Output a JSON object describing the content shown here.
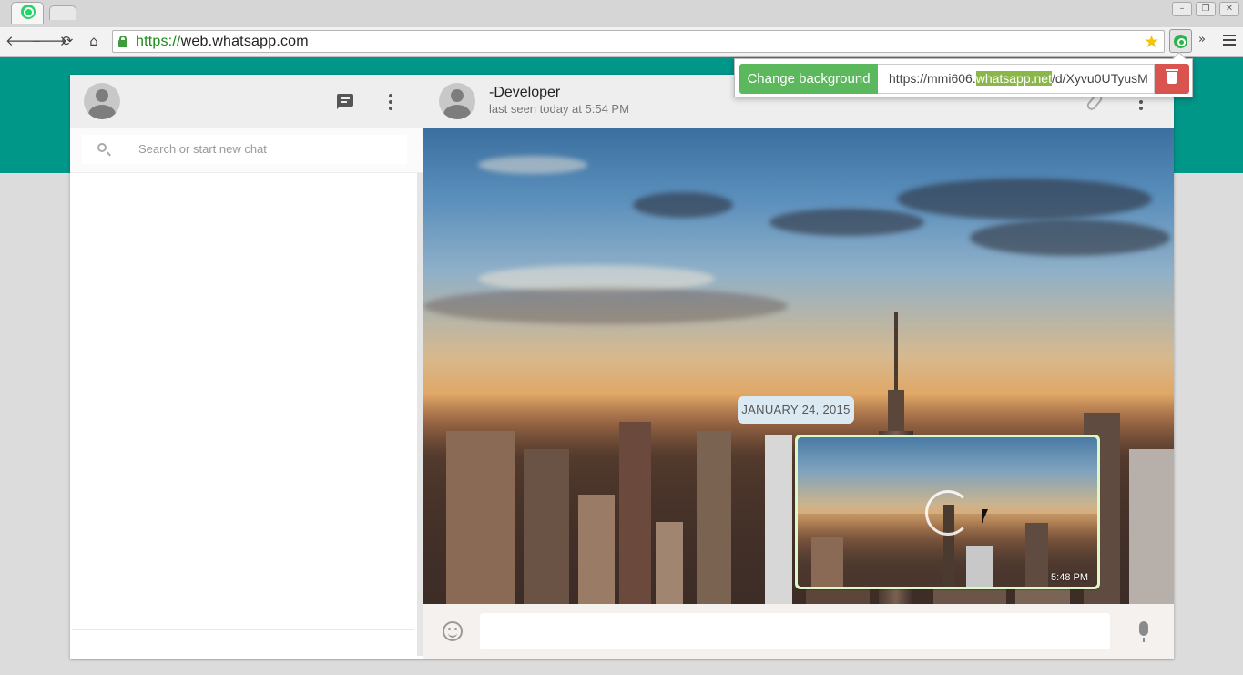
{
  "browser": {
    "url_scheme": "https://",
    "url_host": "web.whatsapp.com",
    "nav": {
      "back": "🡐",
      "forward": "🡒",
      "reload": "⟳",
      "home": "⌂"
    },
    "window_buttons": {
      "minimize": "–",
      "restore": "❐",
      "close": "✕"
    },
    "star_glyph": "★",
    "overflow_glyph": "»"
  },
  "sidebar": {
    "search_placeholder": "Search or start new chat"
  },
  "conversation": {
    "contact_name": "-Developer",
    "contact_status": "last seen today at 5:54 PM",
    "date_divider": "JANUARY 24, 2015",
    "image_message_time": "5:48 PM"
  },
  "extension_popup": {
    "button_label": "Change background",
    "url_prefix": "https://mmi606.",
    "url_highlight": "whatsapp.net",
    "url_suffix": "/d/Xyvu0UTyusM"
  },
  "colors": {
    "brand_teal": "#009688",
    "popup_button": "#5cb85c",
    "delete_button": "#d9534f",
    "bubble_out": "#dcf8c6"
  }
}
